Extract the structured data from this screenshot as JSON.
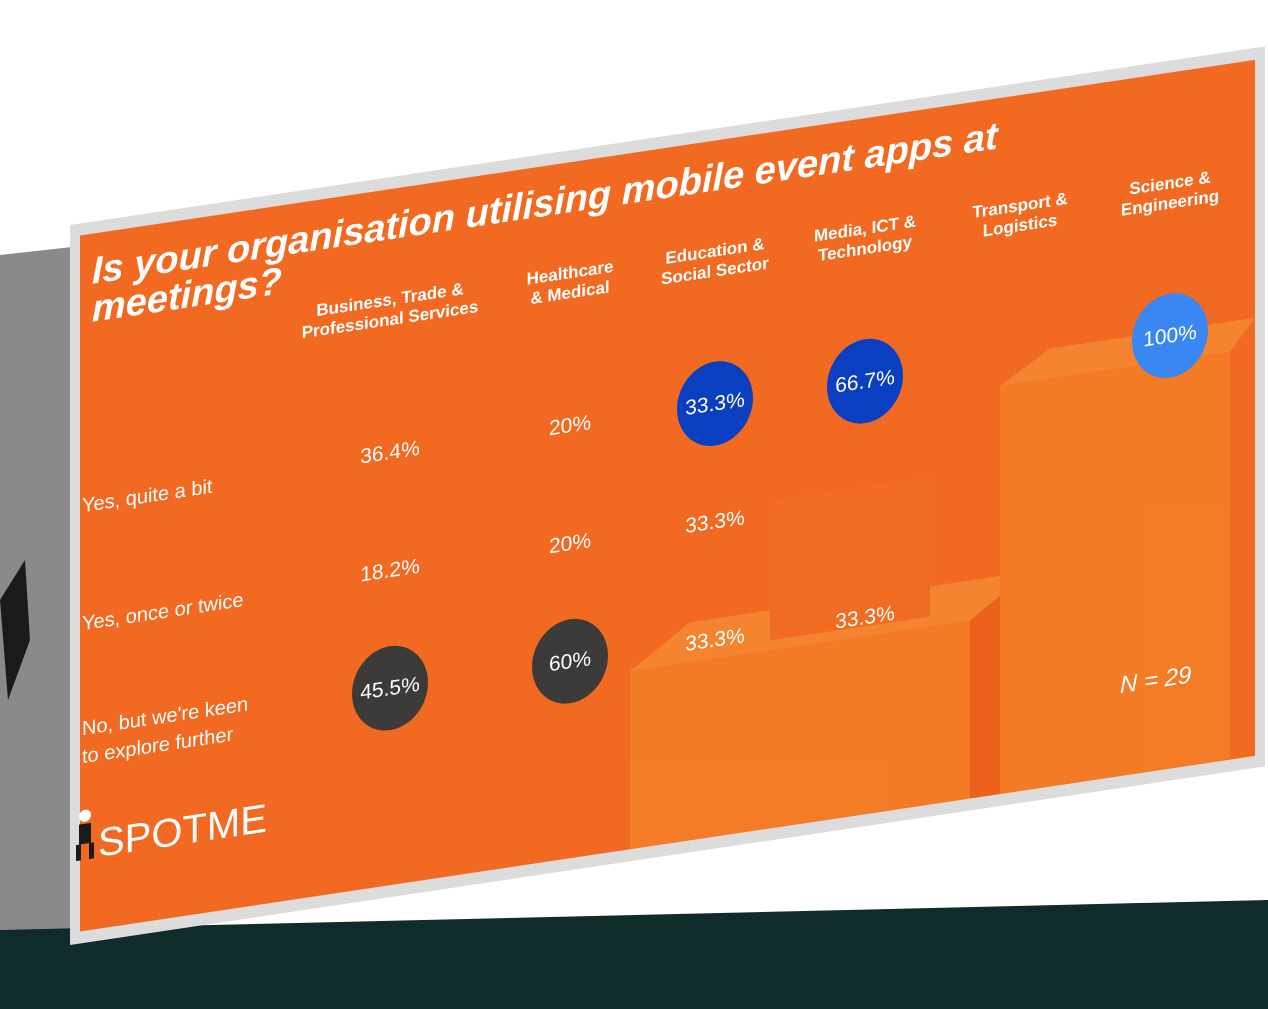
{
  "chart_data": {
    "type": "table",
    "title": "Is your organisation utilising mobile event apps at meetings?",
    "categories": [
      "Business, Trade & Professional Services",
      "Healthcare & Medical",
      "Education & Social Sector",
      "Media, ICT & Technology",
      "Transport & Logistics",
      "Science & Engineering"
    ],
    "series": [
      {
        "name": "Yes, quite a bit",
        "values": [
          36.4,
          20,
          33.3,
          66.7,
          null,
          100
        ],
        "labels": [
          "36.4%",
          "20%",
          "33.3%",
          "66.7%",
          "",
          "100%"
        ]
      },
      {
        "name": "Yes, once or twice",
        "values": [
          18.2,
          20,
          33.3,
          null,
          null,
          null
        ],
        "labels": [
          "18.2%",
          "20%",
          "33.3%",
          "",
          "",
          ""
        ]
      },
      {
        "name": "No, but we're keen to explore further",
        "values": [
          45.5,
          60,
          33.3,
          33.3,
          null,
          null
        ],
        "labels": [
          "45.5%",
          "60%",
          "33.3%",
          "33.3%",
          "",
          ""
        ]
      }
    ],
    "row_label_lines": [
      [
        "Yes, quite a bit"
      ],
      [
        "Yes, once or twice"
      ],
      [
        "No, but we're keen",
        "to explore further"
      ]
    ],
    "header_lines": [
      [
        "Business, Trade &",
        "Professional Services"
      ],
      [
        "Healthcare",
        "& Medical"
      ],
      [
        "Education &",
        "Social Sector"
      ],
      [
        "Media, ICT &",
        "Technology"
      ],
      [
        "Transport &",
        "Logistics"
      ],
      [
        "Science &",
        "Engineering"
      ]
    ],
    "highlights": [
      {
        "row": 0,
        "col": 2,
        "color": "#0b3fc2"
      },
      {
        "row": 0,
        "col": 3,
        "color": "#0b3fc2"
      },
      {
        "row": 0,
        "col": 5,
        "color": "#3a86f2"
      },
      {
        "row": 2,
        "col": 0,
        "color": "#3c3b39"
      },
      {
        "row": 2,
        "col": 1,
        "color": "#3c3b39"
      }
    ],
    "note": "N = 29"
  },
  "title_lines": [
    "Is your organisation utilising mobile event apps at",
    "meetings?"
  ],
  "logo": {
    "text": "SPOTME"
  },
  "colors": {
    "slide": "#f26a22",
    "frame": "#d9d9d9",
    "stage": "#0f2b2a",
    "text": "#ffffff"
  }
}
